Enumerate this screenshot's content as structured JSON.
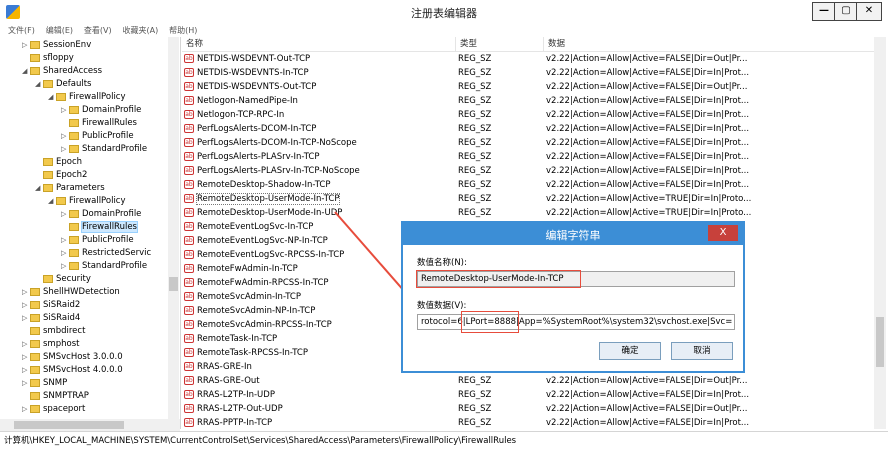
{
  "window": {
    "title": "注册表编辑器",
    "min_label": "—",
    "max_label": "▢",
    "close_label": "✕"
  },
  "menu": [
    "文件(F)",
    "编辑(E)",
    "查看(V)",
    "收藏夹(A)",
    "帮助(H)"
  ],
  "tree": [
    {
      "label": "SessionEnv",
      "indent": 1,
      "toggle": "▷"
    },
    {
      "label": "sfloppy",
      "indent": 1,
      "toggle": ""
    },
    {
      "label": "SharedAccess",
      "indent": 1,
      "toggle": "◢"
    },
    {
      "label": "Defaults",
      "indent": 2,
      "toggle": "◢"
    },
    {
      "label": "FirewallPolicy",
      "indent": 3,
      "toggle": "◢"
    },
    {
      "label": "DomainProfile",
      "indent": 4,
      "toggle": "▷"
    },
    {
      "label": "FirewallRules",
      "indent": 4,
      "toggle": ""
    },
    {
      "label": "PublicProfile",
      "indent": 4,
      "toggle": "▷"
    },
    {
      "label": "StandardProfile",
      "indent": 4,
      "toggle": "▷"
    },
    {
      "label": "Epoch",
      "indent": 2,
      "toggle": ""
    },
    {
      "label": "Epoch2",
      "indent": 2,
      "toggle": ""
    },
    {
      "label": "Parameters",
      "indent": 2,
      "toggle": "◢"
    },
    {
      "label": "FirewallPolicy",
      "indent": 3,
      "toggle": "◢"
    },
    {
      "label": "DomainProfile",
      "indent": 4,
      "toggle": "▷"
    },
    {
      "label": "FirewallRules",
      "indent": 4,
      "toggle": "",
      "selected": true
    },
    {
      "label": "PublicProfile",
      "indent": 4,
      "toggle": "▷"
    },
    {
      "label": "RestrictedServic",
      "indent": 4,
      "toggle": "▷"
    },
    {
      "label": "StandardProfile",
      "indent": 4,
      "toggle": "▷"
    },
    {
      "label": "Security",
      "indent": 2,
      "toggle": ""
    },
    {
      "label": "ShellHWDetection",
      "indent": 1,
      "toggle": "▷"
    },
    {
      "label": "SiSRaid2",
      "indent": 1,
      "toggle": "▷"
    },
    {
      "label": "SiSRaid4",
      "indent": 1,
      "toggle": "▷"
    },
    {
      "label": "smbdirect",
      "indent": 1,
      "toggle": ""
    },
    {
      "label": "smphost",
      "indent": 1,
      "toggle": "▷"
    },
    {
      "label": "SMSvcHost 3.0.0.0",
      "indent": 1,
      "toggle": "▷"
    },
    {
      "label": "SMSvcHost 4.0.0.0",
      "indent": 1,
      "toggle": "▷"
    },
    {
      "label": "SNMP",
      "indent": 1,
      "toggle": "▷"
    },
    {
      "label": "SNMPTRAP",
      "indent": 1,
      "toggle": ""
    },
    {
      "label": "spaceport",
      "indent": 1,
      "toggle": "▷"
    }
  ],
  "columns": {
    "name": "名称",
    "type": "类型",
    "data": "数据"
  },
  "values": [
    {
      "name": "NETDIS-WSDEVNT-Out-TCP",
      "type": "REG_SZ",
      "data": "v2.22|Action=Allow|Active=FALSE|Dir=Out|Pr..."
    },
    {
      "name": "NETDIS-WSDEVNTS-In-TCP",
      "type": "REG_SZ",
      "data": "v2.22|Action=Allow|Active=FALSE|Dir=In|Prot..."
    },
    {
      "name": "NETDIS-WSDEVNTS-Out-TCP",
      "type": "REG_SZ",
      "data": "v2.22|Action=Allow|Active=FALSE|Dir=Out|Pr..."
    },
    {
      "name": "Netlogon-NamedPipe-In",
      "type": "REG_SZ",
      "data": "v2.22|Action=Allow|Active=FALSE|Dir=In|Prot..."
    },
    {
      "name": "Netlogon-TCP-RPC-In",
      "type": "REG_SZ",
      "data": "v2.22|Action=Allow|Active=FALSE|Dir=In|Prot..."
    },
    {
      "name": "PerfLogsAlerts-DCOM-In-TCP",
      "type": "REG_SZ",
      "data": "v2.22|Action=Allow|Active=FALSE|Dir=In|Prot..."
    },
    {
      "name": "PerfLogsAlerts-DCOM-In-TCP-NoScope",
      "type": "REG_SZ",
      "data": "v2.22|Action=Allow|Active=FALSE|Dir=In|Prot..."
    },
    {
      "name": "PerfLogsAlerts-PLASrv-In-TCP",
      "type": "REG_SZ",
      "data": "v2.22|Action=Allow|Active=FALSE|Dir=In|Prot..."
    },
    {
      "name": "PerfLogsAlerts-PLASrv-In-TCP-NoScope",
      "type": "REG_SZ",
      "data": "v2.22|Action=Allow|Active=FALSE|Dir=In|Prot..."
    },
    {
      "name": "RemoteDesktop-Shadow-In-TCP",
      "type": "REG_SZ",
      "data": "v2.22|Action=Allow|Active=FALSE|Dir=In|Prot..."
    },
    {
      "name": "RemoteDesktop-UserMode-In-TCP",
      "type": "REG_SZ",
      "data": "v2.22|Action=Allow|Active=TRUE|Dir=In|Proto...",
      "selected": true
    },
    {
      "name": "RemoteDesktop-UserMode-In-UDP",
      "type": "REG_SZ",
      "data": "v2.22|Action=Allow|Active=TRUE|Dir=In|Proto..."
    },
    {
      "name": "RemoteEventLogSvc-In-TCP",
      "type": "",
      "data": ""
    },
    {
      "name": "RemoteEventLogSvc-NP-In-TCP",
      "type": "",
      "data": ""
    },
    {
      "name": "RemoteEventLogSvc-RPCSS-In-TCP",
      "type": "",
      "data": ""
    },
    {
      "name": "RemoteFwAdmin-In-TCP",
      "type": "",
      "data": ""
    },
    {
      "name": "RemoteFwAdmin-RPCSS-In-TCP",
      "type": "",
      "data": ""
    },
    {
      "name": "RemoteSvcAdmin-In-TCP",
      "type": "",
      "data": ""
    },
    {
      "name": "RemoteSvcAdmin-NP-In-TCP",
      "type": "",
      "data": ""
    },
    {
      "name": "RemoteSvcAdmin-RPCSS-In-TCP",
      "type": "",
      "data": ""
    },
    {
      "name": "RemoteTask-In-TCP",
      "type": "",
      "data": ""
    },
    {
      "name": "RemoteTask-RPCSS-In-TCP",
      "type": "",
      "data": ""
    },
    {
      "name": "RRAS-GRE-In",
      "type": "",
      "data": ""
    },
    {
      "name": "RRAS-GRE-Out",
      "type": "REG_SZ",
      "data": "v2.22|Action=Allow|Active=FALSE|Dir=Out|Pr..."
    },
    {
      "name": "RRAS-L2TP-In-UDP",
      "type": "REG_SZ",
      "data": "v2.22|Action=Allow|Active=FALSE|Dir=In|Prot..."
    },
    {
      "name": "RRAS-L2TP-Out-UDP",
      "type": "REG_SZ",
      "data": "v2.22|Action=Allow|Active=FALSE|Dir=Out|Pr..."
    },
    {
      "name": "RRAS-PPTP-In-TCP",
      "type": "REG_SZ",
      "data": "v2.22|Action=Allow|Active=FALSE|Dir=In|Prot..."
    }
  ],
  "status": "计算机\\HKEY_LOCAL_MACHINE\\SYSTEM\\CurrentControlSet\\Services\\SharedAccess\\Parameters\\FirewallPolicy\\FirewallRules",
  "dialog": {
    "title": "编辑字符串",
    "close_label": "X",
    "name_label": "数值名称(N):",
    "name_value": "RemoteDesktop-UserMode-In-TCP",
    "data_label": "数值数据(V):",
    "data_value": "rotocol=6|LPort=8888|App=%SystemRoot%\\system32\\svchost.exe|Svc=",
    "ok_label": "确定",
    "cancel_label": "取消"
  },
  "colors": {
    "dialog_accent": "#3c8ed6",
    "highlight": "#e74c3c",
    "close": "#c7413b"
  }
}
